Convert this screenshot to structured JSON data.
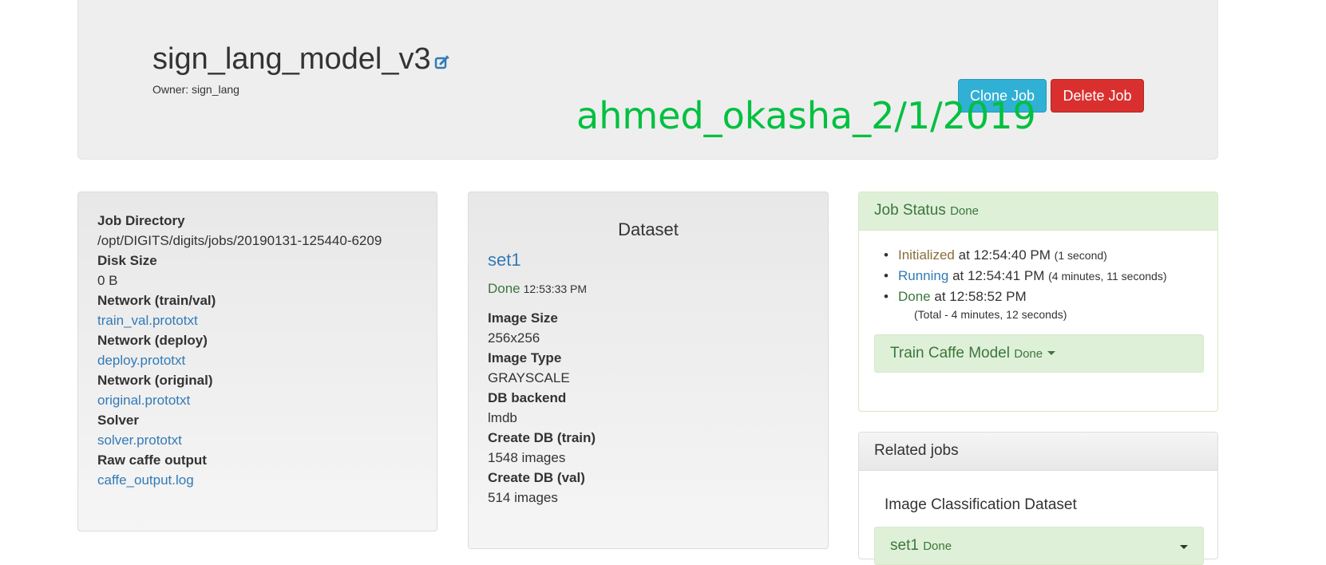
{
  "header": {
    "job_name": "sign_lang_model_v3",
    "owner": "Owner: sign_lang",
    "clone_label": "Clone Job",
    "delete_label": "Delete Job",
    "watermark": "ahmed_okasha_2/1/2019"
  },
  "job_info": {
    "items": [
      {
        "label": "Job Directory",
        "value": "/opt/DIGITS/digits/jobs/20190131-125440-6209"
      },
      {
        "label": "Disk Size",
        "value": "0 B"
      },
      {
        "label": "Network (train/val)",
        "value": "train_val.prototxt"
      },
      {
        "label": "Network (deploy)",
        "value": "deploy.prototxt"
      },
      {
        "label": "Network (original)",
        "value": "original.prototxt"
      },
      {
        "label": "Solver",
        "value": "solver.prototxt"
      },
      {
        "label": "Raw caffe output",
        "value": "caffe_output.log"
      }
    ]
  },
  "dataset": {
    "heading": "Dataset",
    "name": "set1",
    "status": "Done",
    "status_time": "12:53:33 PM",
    "items": [
      {
        "label": "Image Size",
        "value": "256x256"
      },
      {
        "label": "Image Type",
        "value": "GRAYSCALE"
      },
      {
        "label": "DB backend",
        "value": "lmdb"
      },
      {
        "label": "Create DB (train)",
        "value": "1548 images"
      },
      {
        "label": "Create DB (val)",
        "value": "514 images"
      }
    ]
  },
  "job_status": {
    "title": "Job Status",
    "state": "Done",
    "events": [
      {
        "state": "Initialized",
        "at": "at 12:54:40 PM",
        "duration": "(1 second)"
      },
      {
        "state": "Running",
        "at": "at 12:54:41 PM",
        "duration": "(4 minutes, 11 seconds)"
      },
      {
        "state": "Done",
        "at": "at 12:58:52 PM",
        "duration": ""
      }
    ],
    "total": "(Total - 4 minutes, 12 seconds)",
    "task": {
      "label": "Train Caffe Model",
      "state": "Done"
    }
  },
  "related": {
    "title": "Related jobs",
    "type": "Image Classification Dataset",
    "item": {
      "label": "set1",
      "state": "Done"
    }
  },
  "colors": {
    "watermark": "#00c040",
    "clone_button": "#31b0d5",
    "delete_button": "#d9302f",
    "success_bg": "#dff0d8",
    "link": "#337ab7"
  }
}
